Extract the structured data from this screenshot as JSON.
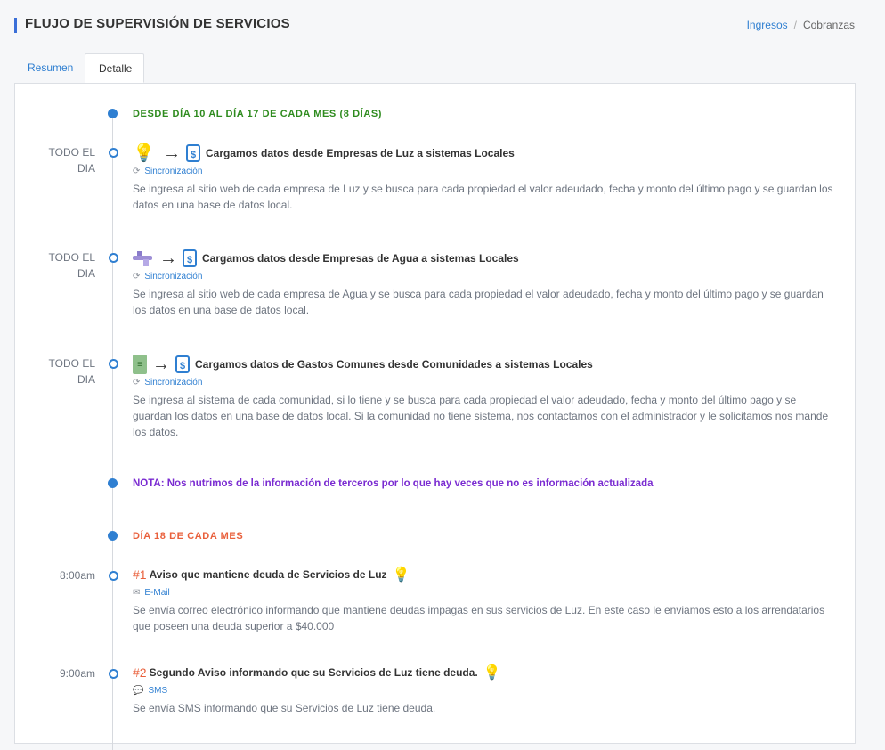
{
  "header": {
    "title": "FLUJO DE SUPERVISIÓN DE SERVICIOS",
    "breadcrumbs": [
      {
        "label": "Ingresos"
      },
      {
        "label": "Cobranzas"
      }
    ]
  },
  "tabs": [
    {
      "label": "Resumen"
    },
    {
      "label": "Detalle"
    }
  ],
  "timeline": {
    "section1": "DESDE DÍA 10 AL DÍA 17 DE CADA MES (8 DÍAS)",
    "entries": [
      {
        "time": "TODO EL DIA",
        "title": "Cargamos datos desde Empresas de Luz a sistemas Locales",
        "tag": "Sincronización",
        "desc": "Se ingresa al sitio web de cada empresa de Luz y se busca para cada propiedad el valor adeudado, fecha y monto del último pago y se guardan los datos en una base de datos local."
      },
      {
        "time": "TODO EL DIA",
        "title": "Cargamos datos desde Empresas de Agua a sistemas Locales",
        "tag": "Sincronización",
        "desc": "Se ingresa al sitio web de cada empresa de Agua y se busca para cada propiedad el valor adeudado, fecha y monto del último pago y se guardan los datos en una base de datos local."
      },
      {
        "time": "TODO EL DIA",
        "title": "Cargamos datos de Gastos Comunes desde Comunidades a sistemas Locales",
        "tag": "Sincronización",
        "desc": "Se ingresa al sistema de cada comunidad, si lo tiene y se busca para cada propiedad el valor adeudado, fecha y monto del último pago y se guardan los datos en una base de datos local. Si la comunidad no tiene sistema, nos contactamos con el administrador y le solicitamos nos mande los datos."
      }
    ],
    "note": "NOTA: Nos nutrimos de la información de terceros por lo que hay veces que no es información actualizada",
    "section2": "DÍA 18 DE CADA MES",
    "notices": [
      {
        "time": "8:00am",
        "number": "#1",
        "title": "Aviso que mantiene deuda de Servicios de Luz",
        "tag": "E-Mail",
        "desc": "Se envía correo electrónico informando que mantiene deudas impagas en sus servicios de Luz. En este caso le enviamos esto a los arrendatarios que poseen una deuda superior a $40.000"
      },
      {
        "time": "9:00am",
        "number": "#2",
        "title": "Segundo Aviso informando que su Servicios de Luz tiene deuda.",
        "tag": "SMS",
        "desc": "Se envía SMS informando que su Servicios de Luz tiene deuda."
      }
    ]
  },
  "icons": {
    "bulb": "lightbulb-icon",
    "arrow": "arrow-right-icon",
    "doc": "invoice-dollar-icon",
    "tap": "water-tap-icon",
    "sheet": "spreadsheet-icon",
    "sync": "sync-icon",
    "mail": "mail-icon",
    "chat": "chat-icon"
  },
  "colors": {
    "accent": "#2f7fd1",
    "green": "#2e8b1e",
    "orange": "#e9603c",
    "purple": "#7a2bd1"
  }
}
